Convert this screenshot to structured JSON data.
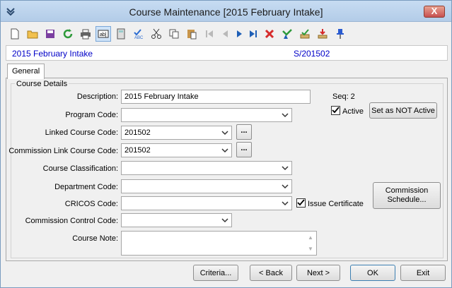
{
  "window": {
    "title": "Course Maintenance  [2015 February Intake]",
    "close_label": "X"
  },
  "toolbar": {
    "icons": [
      "new-icon",
      "open-icon",
      "save-icon",
      "refresh-icon",
      "print-icon",
      "text-field-icon",
      "calculator-icon",
      "spellcheck-icon",
      "cut-icon",
      "copy-icon",
      "paste-icon",
      "first-record-icon",
      "previous-record-icon",
      "next-record-icon",
      "last-record-icon",
      "delete-icon",
      "filter-icon",
      "approve-icon",
      "download-icon",
      "pin-icon"
    ]
  },
  "infobar": {
    "name": "2015 February Intake",
    "code": "S/201502"
  },
  "tabs": [
    {
      "label": "General"
    }
  ],
  "group": {
    "label": "Course Details"
  },
  "form": {
    "description_label": "Description:",
    "description_value": "2015 February Intake",
    "program_code_label": "Program Code:",
    "program_code_value": "",
    "linked_course_label": "Linked Course Code:",
    "linked_course_value": "201502",
    "commission_link_label": "Commission Link Course Code:",
    "commission_link_value": "201502",
    "classification_label": "Course Classification:",
    "classification_value": "",
    "department_label": "Department Code:",
    "department_value": "",
    "cricos_label": "CRICOS Code:",
    "cricos_value": "",
    "commission_control_label": "Commission Control Code:",
    "commission_control_value": "",
    "note_label": "Course Note:",
    "ellipsis": "...",
    "seq_label": "Seq: 2",
    "active_label": "Active",
    "active_checked": true,
    "set_not_active_label": "Set as NOT Active",
    "issue_certificate_label": "Issue Certificate",
    "issue_certificate_checked": true,
    "commission_schedule_line1": "Commission",
    "commission_schedule_line2": "Schedule..."
  },
  "buttons": {
    "criteria": "Criteria...",
    "back": "< Back",
    "next": "Next >",
    "ok": "OK",
    "exit": "Exit"
  }
}
